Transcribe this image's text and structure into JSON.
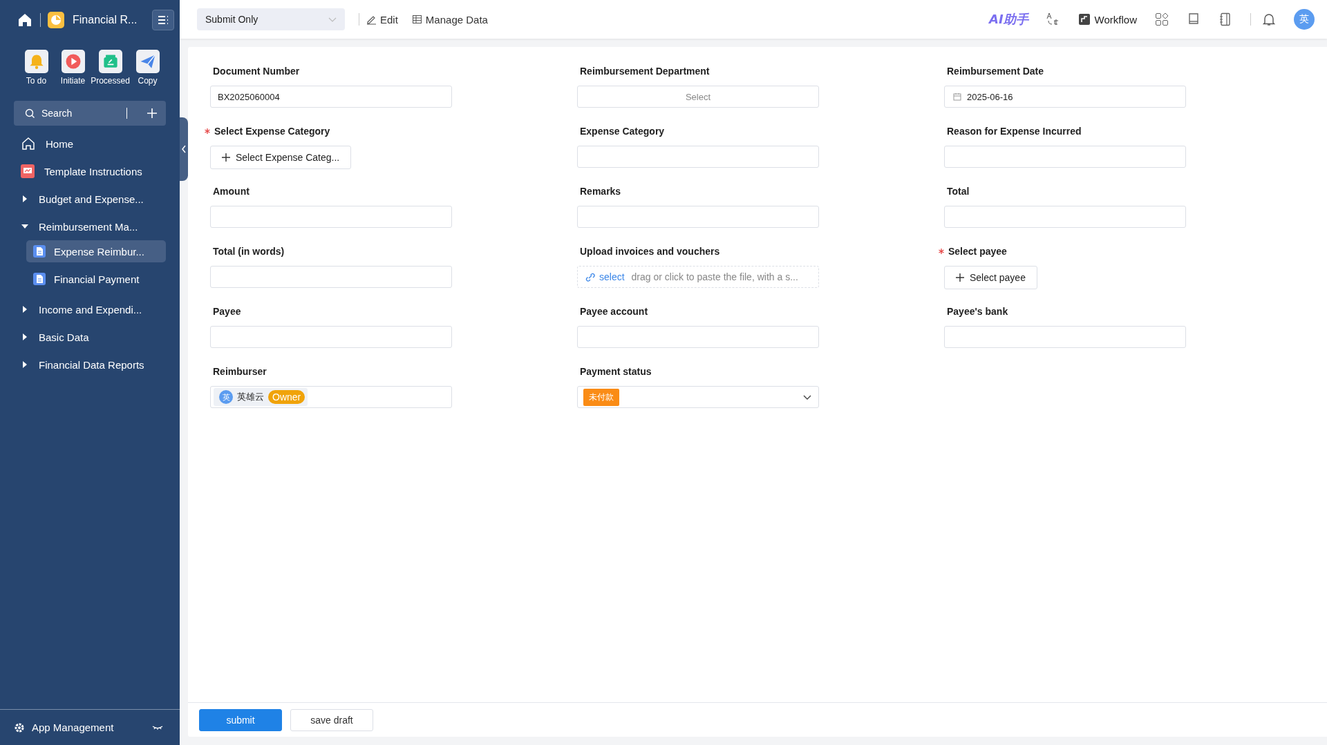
{
  "sidebar": {
    "app_title": "Financial R...",
    "shortcuts": [
      {
        "label": "To do",
        "kind": "bell"
      },
      {
        "label": "Initiate",
        "kind": "play"
      },
      {
        "label": "Processed",
        "kind": "done"
      },
      {
        "label": "Copy",
        "kind": "send"
      }
    ],
    "search": {
      "placeholder": "Search"
    },
    "nav": [
      {
        "label": "Home",
        "kind": "home",
        "selected": false
      },
      {
        "label": "Template Instructions",
        "kind": "page",
        "selected": false
      },
      {
        "label": "Budget and Expense...",
        "kind": "group",
        "expanded": false,
        "selected": false
      },
      {
        "label": "Reimbursement Ma...",
        "kind": "group",
        "expanded": true,
        "selected": false,
        "children": [
          {
            "label": "Expense Reimbur...",
            "selected": true
          },
          {
            "label": "Financial Payment",
            "selected": false
          }
        ]
      },
      {
        "label": "Income and Expendi...",
        "kind": "group",
        "expanded": false,
        "selected": false
      },
      {
        "label": "Basic Data",
        "kind": "group",
        "expanded": false,
        "selected": false
      },
      {
        "label": "Financial Data Reports",
        "kind": "group",
        "expanded": false,
        "selected": false
      }
    ],
    "footer": {
      "label": "App Management"
    }
  },
  "toolbar": {
    "mode": "Submit Only",
    "actions": [
      {
        "label": "Edit",
        "kind": "edit"
      },
      {
        "label": "Manage Data",
        "kind": "table"
      }
    ],
    "ai_label": "AI助手",
    "workflow": "Workflow",
    "avatar": "英"
  },
  "form": {
    "fields": [
      {
        "label": "Document Number",
        "required": false,
        "kind": "text",
        "value": "BX2025060004"
      },
      {
        "label": "Reimbursement Department",
        "required": false,
        "kind": "select",
        "placeholder": "Select"
      },
      {
        "label": "Reimbursement Date",
        "required": false,
        "kind": "date",
        "value": "2025-06-16"
      },
      {
        "label": "Select Expense Category",
        "required": true,
        "kind": "picker",
        "button": "Select Expense Categ..."
      },
      {
        "label": "Expense Category",
        "required": false,
        "kind": "text"
      },
      {
        "label": "Reason for Expense Incurred",
        "required": false,
        "kind": "text"
      },
      {
        "label": "Amount",
        "required": false,
        "kind": "text"
      },
      {
        "label": "Remarks",
        "required": false,
        "kind": "text"
      },
      {
        "label": "Total",
        "required": false,
        "kind": "text"
      },
      {
        "label": "Total (in words)",
        "required": false,
        "kind": "text"
      },
      {
        "label": "Upload invoices and vouchers",
        "required": false,
        "kind": "upload",
        "link": "select",
        "hint": "drag or click to paste the file, with a s..."
      },
      {
        "label": "Select payee",
        "required": true,
        "kind": "picker",
        "button": "Select payee"
      },
      {
        "label": "Payee",
        "required": false,
        "kind": "text"
      },
      {
        "label": "Payee account",
        "required": false,
        "kind": "text"
      },
      {
        "label": "Payee's bank",
        "required": false,
        "kind": "text"
      },
      {
        "label": "Reimburser",
        "required": false,
        "kind": "member",
        "avatar": "英",
        "name": "英雄云",
        "tag": "Owner"
      },
      {
        "label": "Payment status",
        "required": false,
        "kind": "status",
        "tag": "未付款",
        "color": "#fa8c16"
      }
    ]
  },
  "buttons": [
    {
      "label": "submit",
      "kind": "primary"
    },
    {
      "label": "save draft",
      "kind": "default"
    }
  ]
}
